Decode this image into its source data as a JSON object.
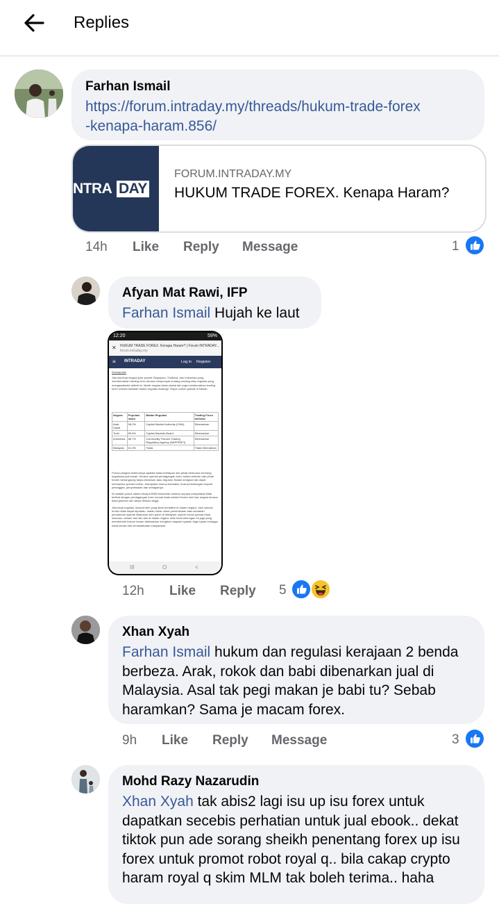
{
  "header": {
    "title": "Replies",
    "back_icon": "arrow-left-icon"
  },
  "colors": {
    "link": "#385898",
    "bubble": "#f0f2f5",
    "like_blue": "#1877f2",
    "meta": "#65676b"
  },
  "comments": [
    {
      "author": "Farhan Ismail",
      "link_text": "https://forum.intraday.my/threads/hukum-trade-forex-kenapa-haram.856/",
      "link_line1": "https://forum.intraday.my/threads/hukum-trade-forex",
      "link_line2": "-kenapa-haram.856/",
      "preview": {
        "logo_left": "NTRA",
        "logo_right": "DAY",
        "domain": "FORUM.INTRADAY.MY",
        "title": "HUKUM TRADE FOREX. Kenapa Haram?"
      },
      "time": "14h",
      "like": "Like",
      "reply": "Reply",
      "message": "Message",
      "reaction_count": "1",
      "reactions": [
        "like-icon"
      ]
    },
    {
      "author": "Afyan Mat Rawi, IFP",
      "mention": "Farhan Ismail",
      "text": " Hujah ke laut",
      "attachment": {
        "status_time": "12:20",
        "status_batt": "59%",
        "url_title": "HUKUM TRADE FOREX. Kenapa Haram? | Forum INTRADAY...",
        "url_sub": "forum.intraday.my",
        "nav_login": "Log in",
        "nav_register": "Register",
        "logo": "INTRADAY",
        "heading": "Kesimpulan",
        "para1": "Jika kita lihat negara jiran seperti Singapura, Thailand, dan Indonesia yang membenarkan trading forex kerana mempunyai undang-undang atau regulasi yang mengawalselia aktiviti ini. Masih negara Islam utama lain juga membenarkan trading forex melalui kawalan badan regulasi masing2. Rujuk contoh jaduali di bawah.",
        "table_headers": [
          "Negara",
          "Populasi Islam",
          "Badan Regulasi",
          "Trading Forex Individu"
        ],
        "table_rows": [
          [
            "Arab Saudi",
            "98.2%",
            "Capital Market Authority (CMA)",
            "Dibenarkan"
          ],
          [
            "Turki",
            "89.5%",
            "Capital Markets Board",
            "Dibenarkan"
          ],
          [
            "Indonesia",
            "86.7%",
            "Commodity Futures Trading Regulatory Agency (BAPPEBTI)",
            "Dibenarkan"
          ],
          [
            "Malaysia",
            "61.3%",
            "Tiada",
            "Tidak Dibenarkan"
          ]
        ],
        "para2": "Punca pangkal sebenarnya apabila tiada ketetapan dari pihak berkuasa memang segalanya jadi susah. Kerana operasi perdagangan forex antara individu dan pihak broker berlangsung tanpa kelulusan atau regulasi. Badan kerajaan tak dapat memantau operasi broker, kewujudan semua transaksi, buat perlindungan deposit pelanggan, penyelesaian dan sebagainya.",
        "para3": "Ini adalah punca utama kenapa BNM keluarkan amaran supaya masyarakat tidak terlibat dengan perdagangan forex secara tidak melalui broker dari luar negara kerana tiada jaminan dan tanya tentuku tinggi.",
        "para4": "Jika tiada regulasi, tiada broker yang akan berdaftar di dalam negara. Jadi operasi broker tidak dapat dipantau, malah sukar untuk pemeriksaan atau semakan pematuhan syariah dilakukan oleh panel di Malaysia, seperti mana operasi bank, insurans, saham dan lain-lain di dalam negara. Atas kecenderungan ini juga yang membentuk hukum haram dikeluarkan mengikut maqasid syariah bagi tujuan menjaga harta benda dan kemaslahatan masyarakat.",
        "nav_buttons": [
          "III",
          "O",
          "<"
        ]
      },
      "time": "12h",
      "like": "Like",
      "reply": "Reply",
      "reaction_count": "5",
      "reactions": [
        "like-icon",
        "haha-icon"
      ]
    },
    {
      "author": "Xhan Xyah",
      "mention": "Farhan Ismail",
      "line1_rest": " hukum dan regulasi kerajaan 2 benda",
      "line2": "berbeza. Arak, rokok dan babi dibenarkan jual di",
      "line3": "Malaysia. Asal tak pegi makan je babi tu? Sebab",
      "line4": "haramkan? Sama je macam forex.",
      "time": "9h",
      "like": "Like",
      "reply": "Reply",
      "message": "Message",
      "reaction_count": "3",
      "reactions": [
        "like-icon"
      ]
    },
    {
      "author": "Mohd Razy Nazarudin",
      "mention": "Xhan Xyah",
      "line1_rest": " tak abis2 lagi isu up isu forex untuk",
      "line2": "dapatkan secebis perhatian untuk jual ebook.. dekat",
      "line3": "tiktok pun ade sorang sheikh penentang forex up isu",
      "line4": "forex untuk promot robot royal q.. bila cakap crypto",
      "line5": "haram royal q skim MLM tak boleh terima.. haha"
    }
  ]
}
